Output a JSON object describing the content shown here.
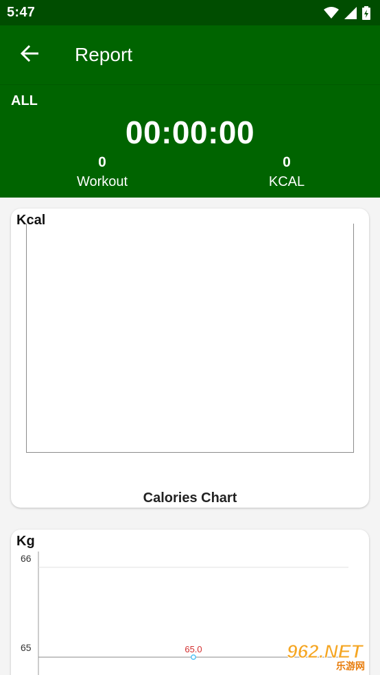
{
  "status_bar": {
    "time": "5:47",
    "icons": [
      "wifi-icon",
      "signal-icon",
      "battery-icon"
    ]
  },
  "app_bar": {
    "title": "Report",
    "back_icon": "arrow-left-icon"
  },
  "summary": {
    "filter": "ALL",
    "duration": "00:00:00",
    "workout_count": "0",
    "workout_label": "Workout",
    "kcal_count": "0",
    "kcal_label": "KCAL"
  },
  "kcal_card": {
    "unit": "Kcal",
    "caption": "Calories Chart"
  },
  "kg_card": {
    "unit": "Kg"
  },
  "chart_data": [
    {
      "type": "bar",
      "ylabel": "Kcal",
      "title": "Calories Chart",
      "categories": [],
      "values": []
    },
    {
      "type": "line",
      "ylabel": "Kg",
      "y_ticks": [
        "66",
        "65"
      ],
      "ylim": [
        65,
        66
      ],
      "series": [
        {
          "values": [
            65.0
          ],
          "value_labels": [
            "65.0"
          ]
        }
      ]
    }
  ],
  "watermark": {
    "text": "962.NET",
    "subtext": "乐游网"
  },
  "colors": {
    "status_bar": "#004d00",
    "primary": "#006400",
    "point_label": "#d32f2f",
    "point": "#4fc3f7"
  }
}
